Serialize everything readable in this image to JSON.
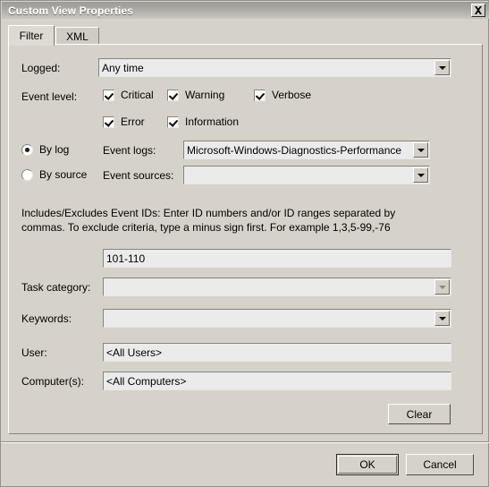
{
  "window": {
    "title": "Custom View Properties",
    "close_icon": "close-icon"
  },
  "tabs": [
    {
      "label": "Filter",
      "active": true
    },
    {
      "label": "XML",
      "active": false
    }
  ],
  "filter": {
    "logged": {
      "label": "Logged:",
      "value": "Any time"
    },
    "event_level": {
      "label": "Event level:",
      "items": [
        {
          "label": "Critical",
          "checked": true
        },
        {
          "label": "Warning",
          "checked": true
        },
        {
          "label": "Verbose",
          "checked": true
        },
        {
          "label": "Error",
          "checked": true
        },
        {
          "label": "Information",
          "checked": true
        }
      ]
    },
    "source_mode": {
      "by_log": {
        "label": "By log",
        "selected": true
      },
      "by_source": {
        "label": "By source",
        "selected": false
      }
    },
    "event_logs": {
      "label": "Event logs:",
      "value": "Microsoft-Windows-Diagnostics-Performance"
    },
    "event_sources": {
      "label": "Event sources:",
      "value": ""
    },
    "event_ids": {
      "help": "Includes/Excludes Event IDs: Enter ID numbers and/or ID ranges separated by commas. To exclude criteria, type a minus sign first. For example 1,3,5-99,-76",
      "value": "101-110"
    },
    "task_category": {
      "label": "Task category:",
      "value": ""
    },
    "keywords": {
      "label": "Keywords:",
      "value": ""
    },
    "user": {
      "label": "User:",
      "value": "<All Users>"
    },
    "computers": {
      "label": "Computer(s):",
      "value": "<All Computers>"
    },
    "clear_label": "Clear"
  },
  "footer": {
    "ok_label": "OK",
    "cancel_label": "Cancel"
  }
}
